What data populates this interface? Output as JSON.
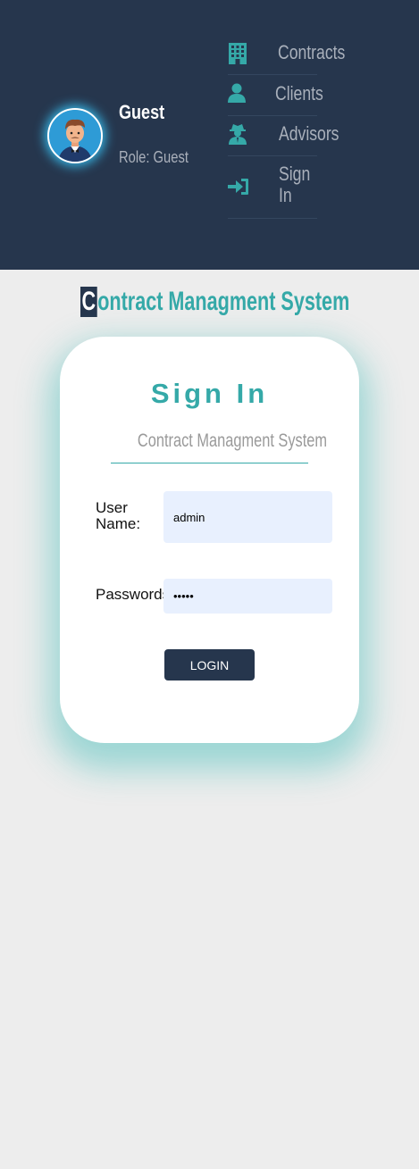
{
  "header": {
    "user": {
      "name": "Guest",
      "role": "Role: Guest"
    },
    "nav": [
      {
        "label": "Contracts",
        "icon": "building-icon"
      },
      {
        "label": "Clients",
        "icon": "user-icon"
      },
      {
        "label": "Advisors",
        "icon": "user-secret-icon"
      },
      {
        "label": "Sign In",
        "icon": "sign-in-icon"
      }
    ]
  },
  "main": {
    "site_title_first": "C",
    "site_title_rest": "ontract Managment System"
  },
  "login_card": {
    "title": "Sign In",
    "subtitle": "Contract Managment System",
    "username_label": "User Name:",
    "username_value": "admin",
    "password_label": "Passwords:",
    "password_value": "admin",
    "login_button": "LOGIN"
  },
  "colors": {
    "header_bg": "#26364d",
    "accent": "#35a9a8",
    "page_bg": "#ededed",
    "input_bg": "#e8f0fe"
  }
}
